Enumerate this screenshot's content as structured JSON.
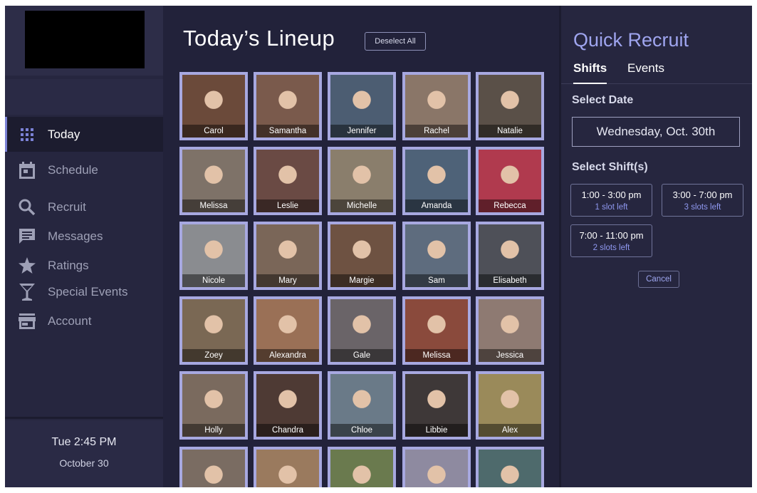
{
  "sidebar": {
    "nav": [
      {
        "label": "Today",
        "icon": "grid-icon"
      },
      {
        "label": "Schedule",
        "icon": "calendar-icon"
      },
      {
        "label": "Recruit",
        "icon": "search-icon"
      },
      {
        "label": "Messages",
        "icon": "message-icon"
      },
      {
        "label": "Ratings",
        "icon": "star-icon"
      },
      {
        "label": "Special Events",
        "icon": "cocktail-icon"
      },
      {
        "label": "Account",
        "icon": "store-icon"
      }
    ],
    "clock": {
      "time": "Tue  2:45 PM",
      "date": "October 30"
    }
  },
  "main": {
    "title": "Today’s Lineup",
    "deselect_label": "Deselect All",
    "people": [
      {
        "name": "Carol",
        "color": "#6b4a3a"
      },
      {
        "name": "Samantha",
        "color": "#7a5a4c"
      },
      {
        "name": "Jennifer",
        "color": "#4c5d72"
      },
      {
        "name": "Rachel",
        "color": "#8a7668"
      },
      {
        "name": "Natalie",
        "color": "#5a5048"
      },
      {
        "name": "Melissa",
        "color": "#7e7268"
      },
      {
        "name": "Leslie",
        "color": "#6a4a44"
      },
      {
        "name": "Michelle",
        "color": "#8a7e6c"
      },
      {
        "name": "Amanda",
        "color": "#4e6278"
      },
      {
        "name": "Rebecca",
        "color": "#b03a4e"
      },
      {
        "name": "Nicole",
        "color": "#8a8c90"
      },
      {
        "name": "Mary",
        "color": "#7a6658"
      },
      {
        "name": "Margie",
        "color": "#6e5242"
      },
      {
        "name": "Sam",
        "color": "#5e6c7e"
      },
      {
        "name": "Elisabeth",
        "color": "#4e5058"
      },
      {
        "name": "Zoey",
        "color": "#7a6854"
      },
      {
        "name": "Alexandra",
        "color": "#9a7056"
      },
      {
        "name": "Gale",
        "color": "#6a6468"
      },
      {
        "name": "Melissa",
        "color": "#8a4a3c"
      },
      {
        "name": "Jessica",
        "color": "#8e7a72"
      },
      {
        "name": "Holly",
        "color": "#7a6a5e"
      },
      {
        "name": "Chandra",
        "color": "#4e3a34"
      },
      {
        "name": "Chloe",
        "color": "#6a7a88"
      },
      {
        "name": "Libbie",
        "color": "#3e3838"
      },
      {
        "name": "Alex",
        "color": "#9a8a5a"
      },
      {
        "name": "",
        "color": "#7a6c62"
      },
      {
        "name": "",
        "color": "#9a7a5e"
      },
      {
        "name": "",
        "color": "#6a7a4e"
      },
      {
        "name": "",
        "color": "#8e8aa0"
      },
      {
        "name": "",
        "color": "#4e6a6c"
      }
    ]
  },
  "quick_recruit": {
    "title": "Quick Recruit",
    "tabs": [
      "Shifts",
      "Events"
    ],
    "select_date_label": "Select Date",
    "date_value": "Wednesday, Oct. 30th",
    "select_shift_label": "Select Shift(s)",
    "shifts": [
      {
        "time": "1:00 - 3:00 pm",
        "slots": "1 slot left"
      },
      {
        "time": "3:00 - 7:00 pm",
        "slots": "3 slots left"
      },
      {
        "time": "7:00 - 11:00 pm",
        "slots": "2 slots left"
      }
    ],
    "cancel_label": "Cancel"
  }
}
